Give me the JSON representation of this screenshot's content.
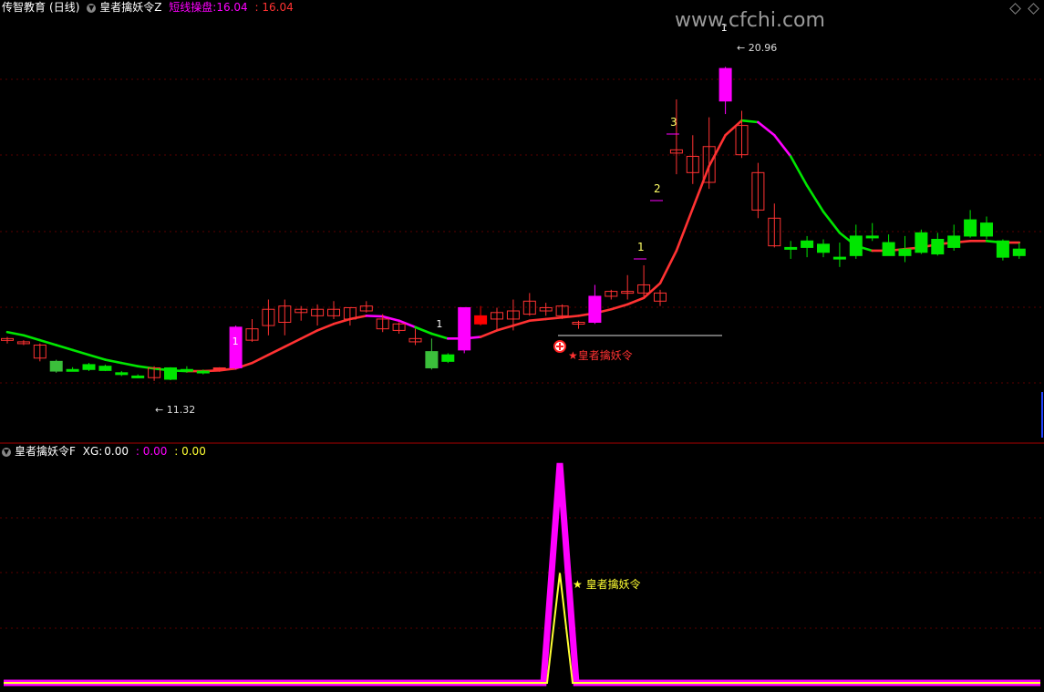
{
  "header_top": {
    "source": "传智教育",
    "period": "(日线)",
    "indicator": "皇者擒妖令Z",
    "line_label": "短线操盘:",
    "line_value": "16.04",
    "line_value2": ": 16.04"
  },
  "watermark": "www.cfchi.com",
  "header_bottom": {
    "indicator": "皇者擒妖令F",
    "xg_label": "XG:",
    "xg_value": "0.00",
    "value2": ": 0.00",
    "value3": ": 0.00"
  },
  "colors": {
    "up": "#ff3232",
    "down": "#00e600",
    "magenta": "#ff00ff",
    "yellow": "#ffff33",
    "grid": "#5a0000",
    "divider": "#aa0000"
  },
  "chart_data": [
    {
      "type": "candlestick",
      "panel": "main",
      "ylim": [
        9.5,
        22.5
      ],
      "candles": [
        {
          "o": 12.55,
          "h": 12.65,
          "l": 12.45,
          "c": 12.6,
          "t": "flat"
        },
        {
          "o": 12.5,
          "h": 12.55,
          "l": 12.4,
          "c": 12.45,
          "t": "flat"
        },
        {
          "o": 12.4,
          "h": 12.45,
          "l": 11.9,
          "c": 12.0,
          "t": "down_hollow"
        },
        {
          "o": 11.9,
          "h": 11.95,
          "l": 11.55,
          "c": 11.6,
          "t": "down_g"
        },
        {
          "o": 11.65,
          "h": 11.72,
          "l": 11.6,
          "c": 11.65,
          "t": "down"
        },
        {
          "o": 11.65,
          "h": 11.85,
          "l": 11.6,
          "c": 11.8,
          "t": "down"
        },
        {
          "o": 11.75,
          "h": 11.8,
          "l": 11.6,
          "c": 11.62,
          "t": "down"
        },
        {
          "o": 11.55,
          "h": 11.6,
          "l": 11.45,
          "c": 11.5,
          "t": "down"
        },
        {
          "o": 11.45,
          "h": 11.5,
          "l": 11.38,
          "c": 11.4,
          "t": "down"
        },
        {
          "o": 11.4,
          "h": 11.75,
          "l": 11.3,
          "c": 11.7,
          "t": "up"
        },
        {
          "o": 11.7,
          "h": 11.72,
          "l": 11.32,
          "c": 11.35,
          "t": "down"
        },
        {
          "o": 11.65,
          "h": 11.75,
          "l": 11.55,
          "c": 11.6,
          "t": "down"
        },
        {
          "o": 11.55,
          "h": 11.65,
          "l": 11.5,
          "c": 11.6,
          "t": "down"
        },
        {
          "o": 11.65,
          "h": 11.72,
          "l": 11.58,
          "c": 11.7,
          "t": "up_solid"
        },
        {
          "o": 11.7,
          "h": 13.0,
          "l": 11.65,
          "c": 12.95,
          "t": "magenta"
        },
        {
          "o": 12.55,
          "h": 13.2,
          "l": 12.5,
          "c": 12.9,
          "t": "up"
        },
        {
          "o": 13.0,
          "h": 13.8,
          "l": 12.7,
          "c": 13.5,
          "t": "up"
        },
        {
          "o": 13.1,
          "h": 13.8,
          "l": 12.7,
          "c": 13.6,
          "t": "up"
        },
        {
          "o": 13.5,
          "h": 13.6,
          "l": 13.15,
          "c": 13.4,
          "t": "up"
        },
        {
          "o": 13.3,
          "h": 13.65,
          "l": 13.0,
          "c": 13.5,
          "t": "up"
        },
        {
          "o": 13.5,
          "h": 13.75,
          "l": 13.2,
          "c": 13.3,
          "t": "up"
        },
        {
          "o": 13.2,
          "h": 13.55,
          "l": 13.0,
          "c": 13.55,
          "t": "up"
        },
        {
          "o": 13.45,
          "h": 13.75,
          "l": 13.4,
          "c": 13.6,
          "t": "up"
        },
        {
          "o": 13.2,
          "h": 13.35,
          "l": 12.8,
          "c": 12.9,
          "t": "up"
        },
        {
          "o": 12.85,
          "h": 13.1,
          "l": 12.75,
          "c": 13.05,
          "t": "up"
        },
        {
          "o": 12.6,
          "h": 12.9,
          "l": 12.4,
          "c": 12.5,
          "t": "up"
        },
        {
          "o": 12.2,
          "h": 12.6,
          "l": 11.65,
          "c": 11.7,
          "t": "down_g"
        },
        {
          "o": 11.9,
          "h": 12.15,
          "l": 11.85,
          "c": 12.1,
          "t": "down"
        },
        {
          "o": 12.25,
          "h": 13.55,
          "l": 12.15,
          "c": 13.55,
          "t": "magenta"
        },
        {
          "o": 13.05,
          "h": 13.6,
          "l": 13.0,
          "c": 13.3,
          "t": "red_solid"
        },
        {
          "o": 13.2,
          "h": 13.55,
          "l": 12.85,
          "c": 13.4,
          "t": "up"
        },
        {
          "o": 13.45,
          "h": 13.8,
          "l": 12.85,
          "c": 13.2,
          "t": "up"
        },
        {
          "o": 13.35,
          "h": 14.0,
          "l": 13.3,
          "c": 13.75,
          "t": "up"
        },
        {
          "o": 13.55,
          "h": 13.7,
          "l": 13.3,
          "c": 13.45,
          "t": "up"
        },
        {
          "o": 13.3,
          "h": 13.65,
          "l": 13.2,
          "c": 13.6,
          "t": "up"
        },
        {
          "o": 13.05,
          "h": 13.15,
          "l": 12.9,
          "c": 13.1,
          "t": "up"
        },
        {
          "o": 13.1,
          "h": 14.25,
          "l": 13.05,
          "c": 13.9,
          "t": "magenta"
        },
        {
          "o": 13.9,
          "h": 14.1,
          "l": 13.8,
          "c": 14.05,
          "t": "up"
        },
        {
          "o": 14.0,
          "h": 14.55,
          "l": 13.8,
          "c": 14.05,
          "t": "up"
        },
        {
          "o": 14.0,
          "h": 14.85,
          "l": 13.9,
          "c": 14.25,
          "t": "up"
        },
        {
          "o": 13.75,
          "h": 14.1,
          "l": 13.6,
          "c": 14.0,
          "t": "up"
        },
        {
          "o": 18.3,
          "h": 19.95,
          "l": 17.65,
          "c": 18.4,
          "t": "up"
        },
        {
          "o": 17.7,
          "h": 18.85,
          "l": 17.35,
          "c": 18.2,
          "t": "up"
        },
        {
          "o": 17.4,
          "h": 19.4,
          "l": 17.2,
          "c": 18.5,
          "t": "up"
        },
        {
          "o": 19.9,
          "h": 20.95,
          "l": 19.5,
          "c": 20.9,
          "t": "magenta"
        },
        {
          "o": 19.15,
          "h": 19.6,
          "l": 18.15,
          "c": 18.25,
          "t": "up"
        },
        {
          "o": 17.7,
          "h": 18.0,
          "l": 16.3,
          "c": 16.55,
          "t": "up"
        },
        {
          "o": 16.3,
          "h": 16.75,
          "l": 15.4,
          "c": 15.45,
          "t": "up"
        },
        {
          "o": 15.4,
          "h": 15.6,
          "l": 15.05,
          "c": 15.35,
          "t": "down"
        },
        {
          "o": 15.4,
          "h": 15.75,
          "l": 15.1,
          "c": 15.6,
          "t": "down"
        },
        {
          "o": 15.5,
          "h": 15.65,
          "l": 15.1,
          "c": 15.25,
          "t": "down"
        },
        {
          "o": 15.1,
          "h": 15.55,
          "l": 14.8,
          "c": 15.05,
          "t": "down"
        },
        {
          "o": 15.75,
          "h": 16.1,
          "l": 15.05,
          "c": 15.15,
          "t": "down"
        },
        {
          "o": 15.75,
          "h": 16.15,
          "l": 15.6,
          "c": 15.7,
          "t": "down"
        },
        {
          "o": 15.55,
          "h": 15.8,
          "l": 15.15,
          "c": 15.15,
          "t": "down"
        },
        {
          "o": 15.35,
          "h": 15.75,
          "l": 14.95,
          "c": 15.15,
          "t": "down"
        },
        {
          "o": 15.85,
          "h": 15.95,
          "l": 15.2,
          "c": 15.25,
          "t": "down"
        },
        {
          "o": 15.65,
          "h": 15.85,
          "l": 15.15,
          "c": 15.2,
          "t": "down"
        },
        {
          "o": 15.75,
          "h": 16.1,
          "l": 15.3,
          "c": 15.4,
          "t": "down"
        },
        {
          "o": 16.25,
          "h": 16.55,
          "l": 15.7,
          "c": 15.75,
          "t": "down"
        },
        {
          "o": 16.15,
          "h": 16.35,
          "l": 15.65,
          "c": 15.75,
          "t": "down"
        },
        {
          "o": 15.6,
          "h": 15.65,
          "l": 15.0,
          "c": 15.1,
          "t": "down"
        },
        {
          "o": 15.35,
          "h": 15.55,
          "l": 15.05,
          "c": 15.15,
          "t": "down"
        }
      ],
      "ma_line": [
        12.8,
        12.7,
        12.55,
        12.4,
        12.25,
        12.1,
        11.95,
        11.85,
        11.75,
        11.68,
        11.62,
        11.6,
        11.6,
        11.62,
        11.68,
        11.85,
        12.1,
        12.35,
        12.6,
        12.85,
        13.05,
        13.2,
        13.3,
        13.28,
        13.15,
        12.95,
        12.75,
        12.6,
        12.6,
        12.65,
        12.85,
        13.0,
        13.15,
        13.2,
        13.25,
        13.3,
        13.38,
        13.5,
        13.65,
        13.85,
        14.3,
        15.3,
        16.6,
        17.9,
        18.85,
        19.3,
        19.25,
        18.85,
        18.2,
        17.3,
        16.5,
        15.85,
        15.45,
        15.3,
        15.3,
        15.35,
        15.4,
        15.5,
        15.55,
        15.6,
        15.6,
        15.55,
        15.55
      ],
      "annotations": [
        {
          "label": "1",
          "type": "marker_above"
        },
        {
          "label": "1",
          "type": "marker_above"
        },
        {
          "label": "1",
          "type": "sequence"
        },
        {
          "label": "2",
          "type": "sequence"
        },
        {
          "label": "3",
          "type": "sequence"
        },
        {
          "label": "1",
          "type": "marker_above"
        },
        {
          "label": "11.32",
          "type": "low"
        },
        {
          "label": "20.96",
          "type": "high"
        },
        {
          "label": "★皇者擒妖令",
          "type": "signal"
        }
      ]
    },
    {
      "type": "line",
      "panel": "sub",
      "ylim": [
        0,
        1
      ],
      "series": [
        {
          "name": "XG",
          "color": "magenta"
        },
        {
          "color": "yellow"
        }
      ],
      "spike": {
        "magenta_peak": 1.0,
        "yellow_peak": 0.5
      },
      "annotation": "★ 皇者擒妖令"
    }
  ]
}
